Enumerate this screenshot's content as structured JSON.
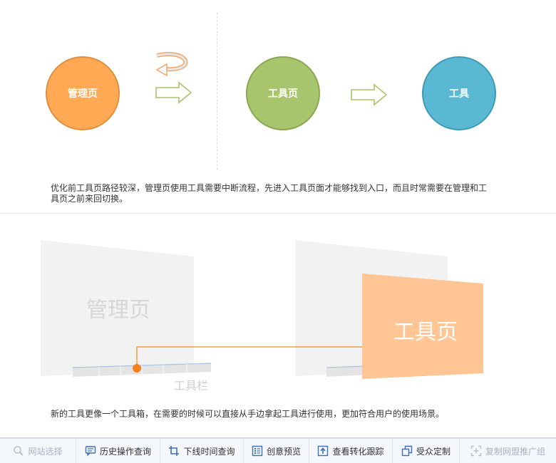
{
  "top_diagram": {
    "circle_manage": "管理页",
    "circle_tool_page": "工具页",
    "circle_tool": "工具",
    "colors": {
      "manage": "#ffa955",
      "tool_page": "#a8c46c",
      "tool": "#5ab8d3"
    }
  },
  "caption_top": {
    "line1": "优化前工具页路径较深，管理页使用工具需要中断流程，先进入工具页面才能够找到入口，而且时常需要在管理和工",
    "line2": "具页之前来回切换。"
  },
  "bottom_diagram": {
    "manage_panel_label": "管理页",
    "toolbar_label": "工具栏",
    "tool_panel_label": "工具页",
    "colors": {
      "accent": "#ffc594",
      "dot": "#f58220"
    }
  },
  "caption_bottom": "新的工具更像一个工具箱，在需要的时候可以直接从手边拿起工具进行使用，更加符合用户的使用场景。",
  "footer": {
    "items": [
      {
        "label": "网站选择",
        "icon": "search-icon",
        "disabled": true
      },
      {
        "label": "历史操作查询",
        "icon": "chat-icon"
      },
      {
        "label": "下线时间查询",
        "icon": "crop-icon"
      },
      {
        "label": "创意预览",
        "icon": "list-icon"
      },
      {
        "label": "查看转化跟踪",
        "icon": "upload-icon"
      },
      {
        "label": "受众定制",
        "icon": "copy-icon"
      },
      {
        "label": "复制网盟推广组",
        "icon": "add-icon",
        "disabled": true
      }
    ]
  }
}
